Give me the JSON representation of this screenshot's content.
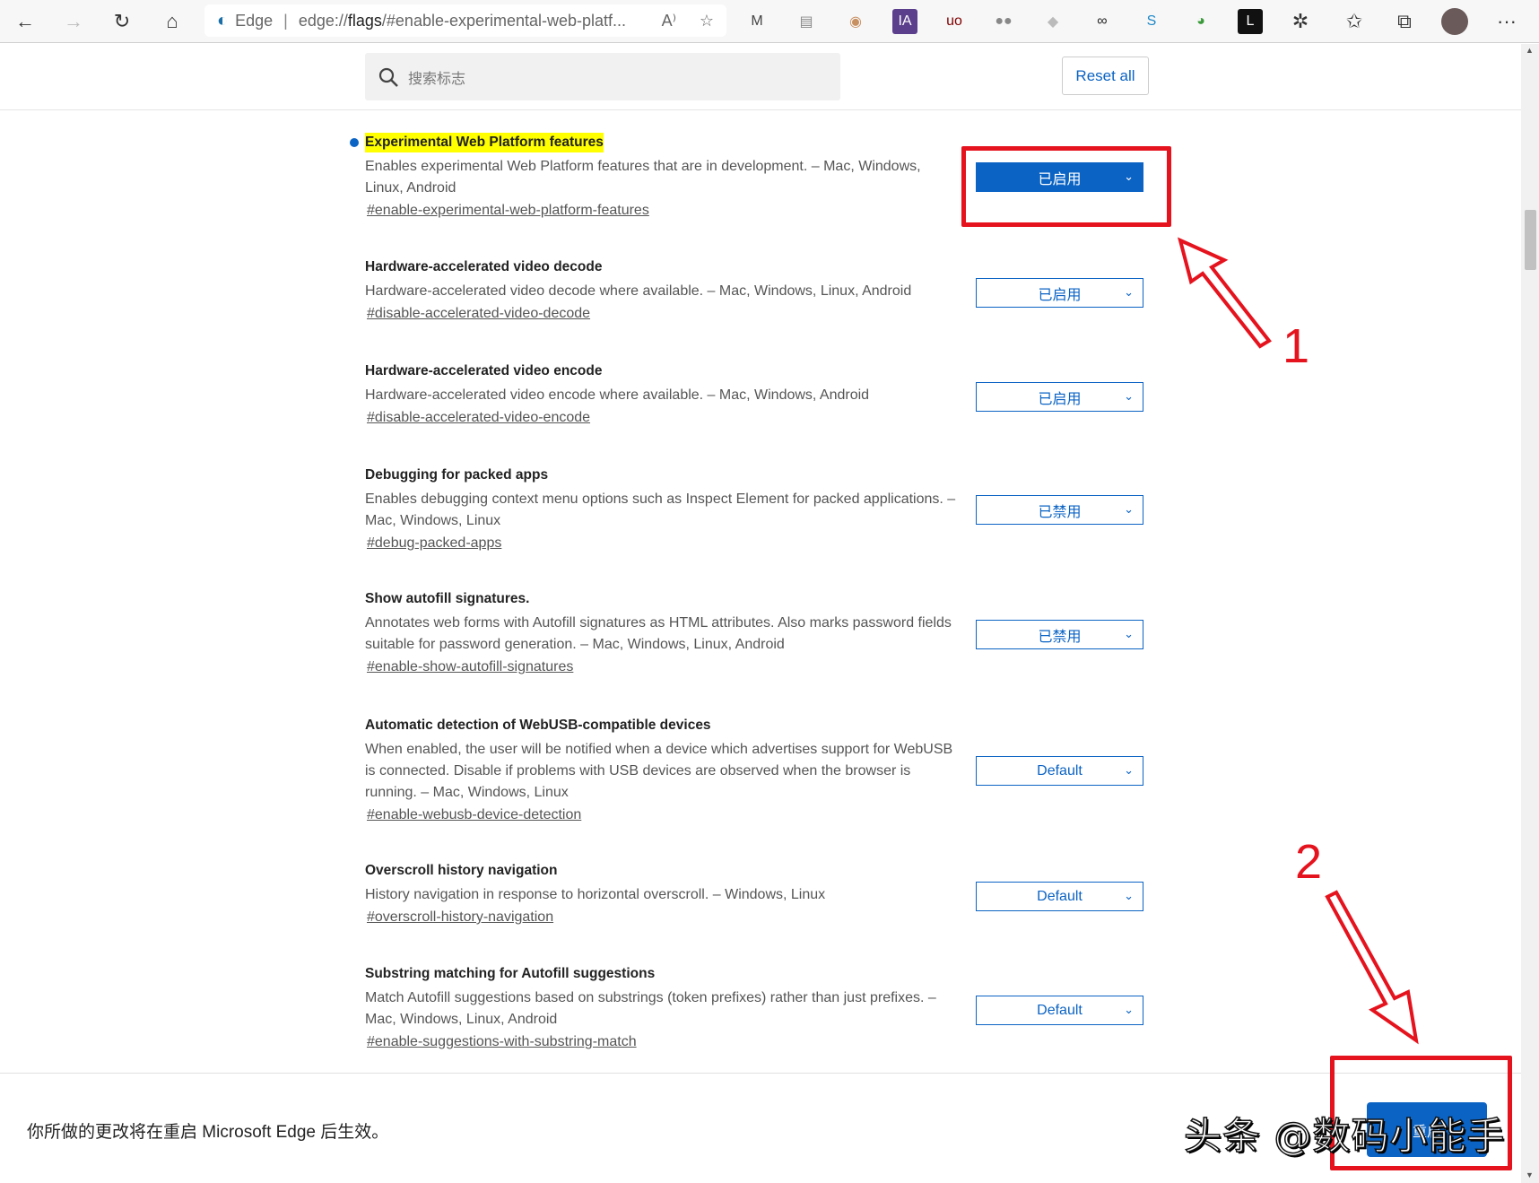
{
  "browser": {
    "brand": "Edge",
    "url": "edge://flags/#enable-experimental-web-platf...",
    "url_host": "flags",
    "url_prefix": "edge://",
    "url_suffix": "/#enable-experimental-web-platf...",
    "more_label": "···"
  },
  "extensions": [
    {
      "name": "shield-extension-icon",
      "glyph": "M",
      "color": "#444"
    },
    {
      "name": "reader-extension-icon",
      "glyph": "▤",
      "color": "#888"
    },
    {
      "name": "owl-extension-icon",
      "glyph": "◉",
      "color": "#c89060"
    },
    {
      "name": "ia-extension-icon",
      "glyph": "IA",
      "color": "#5b3f8c"
    },
    {
      "name": "ublock-extension-icon",
      "glyph": "uo",
      "color": "#800000"
    },
    {
      "name": "ghost-extension-icon",
      "glyph": "●●",
      "color": "#888"
    },
    {
      "name": "grey-shield-extension-icon",
      "glyph": "◆",
      "color": "#bbb"
    },
    {
      "name": "infinity-extension-icon",
      "glyph": "∞",
      "color": "#222"
    },
    {
      "name": "s-extension-icon",
      "glyph": "S",
      "color": "#1e88c8"
    },
    {
      "name": "globe-extension-icon",
      "glyph": "◕",
      "color": "#3a9a3a"
    },
    {
      "name": "l-extension-icon",
      "glyph": "L",
      "color": "#111"
    }
  ],
  "search": {
    "placeholder": "搜索标志"
  },
  "reset_all": "Reset all",
  "flags": [
    {
      "title": "Experimental Web Platform features",
      "desc": "Enables experimental Web Platform features that are in development. – Mac, Windows, Linux, Android",
      "link": "#enable-experimental-web-platform-features",
      "value": "已启用",
      "highlighted": true
    },
    {
      "title": "Hardware-accelerated video decode",
      "desc": "Hardware-accelerated video decode where available. – Mac, Windows, Linux, Android",
      "link": "#disable-accelerated-video-decode",
      "value": "已启用"
    },
    {
      "title": "Hardware-accelerated video encode",
      "desc": "Hardware-accelerated video encode where available. – Mac, Windows, Android",
      "link": "#disable-accelerated-video-encode",
      "value": "已启用"
    },
    {
      "title": "Debugging for packed apps",
      "desc": "Enables debugging context menu options such as Inspect Element for packed applications. – Mac, Windows, Linux",
      "link": "#debug-packed-apps",
      "value": "已禁用"
    },
    {
      "title": "Show autofill signatures.",
      "desc": "Annotates web forms with Autofill signatures as HTML attributes. Also marks password fields suitable for password generation. – Mac, Windows, Linux, Android",
      "link": "#enable-show-autofill-signatures",
      "value": "已禁用"
    },
    {
      "title": "Automatic detection of WebUSB-compatible devices",
      "desc": "When enabled, the user will be notified when a device which advertises support for WebUSB is connected. Disable if problems with USB devices are observed when the browser is running. – Mac, Windows, Linux",
      "link": "#enable-webusb-device-detection",
      "value": "Default"
    },
    {
      "title": "Overscroll history navigation",
      "desc": "History navigation in response to horizontal overscroll. – Windows, Linux",
      "link": "#overscroll-history-navigation",
      "value": "Default"
    },
    {
      "title": "Substring matching for Autofill suggestions",
      "desc": "Match Autofill suggestions based on substrings (token prefixes) rather than just prefixes. – Mac, Windows, Linux, Android",
      "link": "#enable-suggestions-with-substring-match",
      "value": "Default"
    }
  ],
  "bottom": {
    "message": "你所做的更改将在重启 Microsoft Edge 后生效。",
    "restart_label": "重启"
  },
  "annotations": {
    "label1": "1",
    "label2": "2",
    "color": "#e5131d"
  },
  "watermark": "头条 @数码小能手",
  "colors": {
    "accent": "#0b63c4",
    "highlight": "#ffff00"
  }
}
